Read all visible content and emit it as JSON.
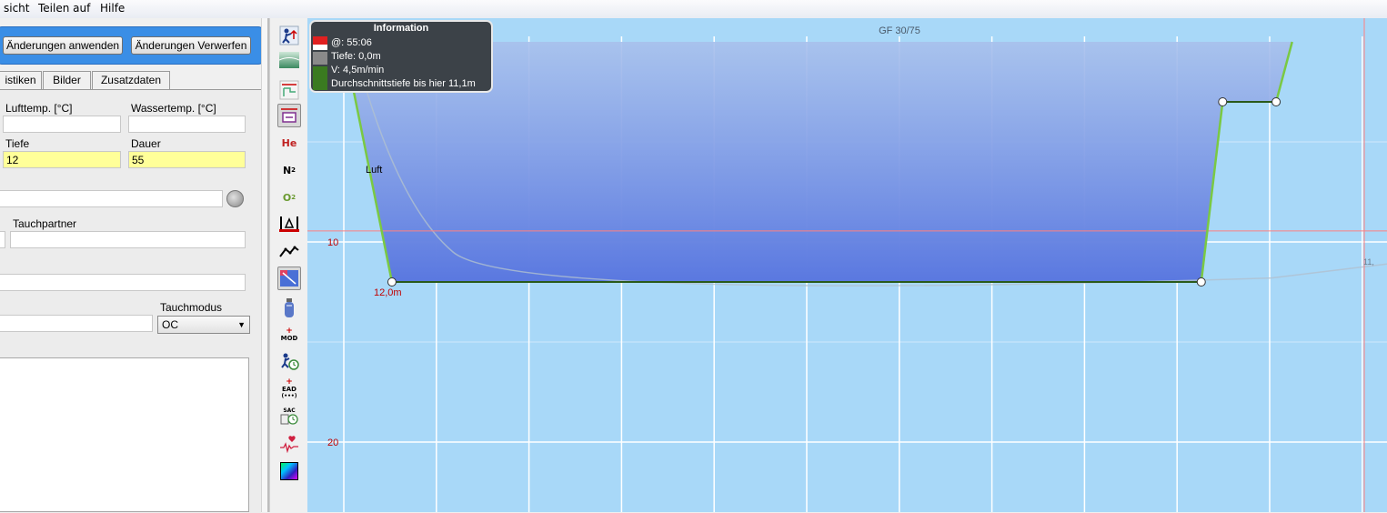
{
  "menu": {
    "items": [
      "sicht",
      "Teilen auf",
      "Hilfe"
    ]
  },
  "actions": {
    "apply_label": "Änderungen anwenden",
    "discard_label": "Änderungen Verwerfen"
  },
  "tabs": [
    "istiken",
    "Bilder",
    "Zusatzdaten"
  ],
  "form": {
    "air_temp_label": "Lufttemp. [°C]",
    "air_temp_value": "",
    "water_temp_label": "Wassertemp. [°C]",
    "water_temp_value": "",
    "depth_label": "Tiefe",
    "depth_value": "12",
    "duration_label": "Dauer",
    "duration_value": "55",
    "location_value": "",
    "buddy_label": "Tauchpartner",
    "buddy_value": "",
    "other_value": "",
    "mode_label": "Tauchmodus",
    "mode_value": "OC",
    "suit_value": ""
  },
  "toolbar_icons": [
    "diver-ascend-icon",
    "gradient-icon",
    "ceiling-icon",
    "deco-calc-icon",
    "helium-icon",
    "nitrogen-icon",
    "oxygen-icon",
    "delta-icon",
    "profile-line-icon",
    "heatmap-toggle-icon",
    "bottle-icon",
    "mod-icon",
    "diver-time-icon",
    "ead-icon",
    "sac-icon",
    "heartrate-icon",
    "color-map-icon"
  ],
  "toolbar_text": {
    "he": "He",
    "n2": "N",
    "o2": "O",
    "mod": "MOD",
    "ead": "EAD",
    "sac": "SAC"
  },
  "plot": {
    "gf_label": "GF 30/75",
    "depth_ticks": [
      {
        "value": 10,
        "label": "10"
      },
      {
        "value": 20,
        "label": "20"
      }
    ],
    "max_depth_label": "12,0m",
    "gas_label": "Luft",
    "ceiling_value_label": "11,",
    "colors": {
      "background": "#a8d8f8",
      "profile_fill": "#5a78e0",
      "profile_line": "#7ac943",
      "grid": "#ffffff",
      "crosshair": "#ff8080"
    }
  },
  "chart_data": {
    "type": "line",
    "series": [],
    "x_unit": "min",
    "y_unit": "m",
    "y_axis": "depth, increasing downward",
    "profile": [
      {
        "x": 0,
        "y": 0
      },
      {
        "x": 2.7,
        "y": 12
      },
      {
        "x": 48.1,
        "y": 12
      },
      {
        "x": 49.3,
        "y": 3
      },
      {
        "x": 52.3,
        "y": 3
      },
      {
        "x": 53.2,
        "y": 0
      }
    ],
    "depth_ticks": [
      10,
      20
    ],
    "max_depth": 12.0,
    "gas": "Luft",
    "gf": "GF 30/75"
  },
  "info_box": {
    "title": "Information",
    "time": "@: 55:06",
    "depth": "Tiefe: 0,0m",
    "rate": "V: 4,5m/min",
    "avg_depth": "Durchschnittstiefe bis hier 11,1m"
  }
}
